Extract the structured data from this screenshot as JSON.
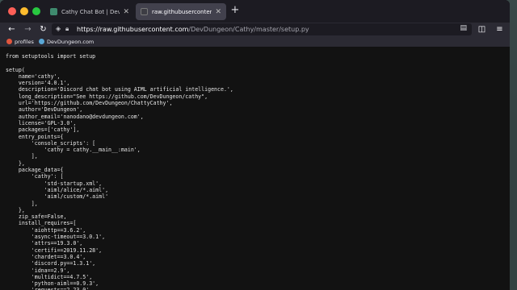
{
  "browser": {
    "tabs": [
      {
        "title": "Cathy Chat Bot | DevDungeon",
        "active": false,
        "close_icon": "close-icon"
      },
      {
        "title": "raw.githubusercontent.com/DevDungeon/Cathy/master/setup.py",
        "active": true,
        "close_icon": "close-icon"
      }
    ],
    "new_tab_label": "+",
    "url_host": "https://raw.githubusercontent.com",
    "url_path": "/DevDungeon/Cathy/master/setup.py",
    "bookmarks": [
      {
        "label": "profiles"
      },
      {
        "label": "DevDungeon.com"
      }
    ],
    "colors": {
      "tab_active": "#42414d",
      "toolbar": "#2b2a33",
      "close_red": "#ff5f57",
      "minimize_yellow": "#febc2e",
      "zoom_green": "#28c840"
    }
  },
  "document": {
    "code_lines": [
      "from setuptools import setup",
      "",
      "setup(",
      "    name='cathy',",
      "    version='4.0.1',",
      "    description='Discord chat bot using AIML artificial intelligence.',",
      "    long_description=\"See https://github.com/DevDungeon/cathy\",",
      "    url='https://github.com/DevDungeon/ChattyCathy',",
      "    author='DevDungeon',",
      "    author_email='nanodano@devdungeon.com',",
      "    license='GPL-3.0',",
      "    packages=['cathy'],",
      "    entry_points={",
      "        'console_scripts': [",
      "            'cathy = cathy.__main__:main',",
      "        ],",
      "    },",
      "    package_data={",
      "        'cathy': [",
      "            'std-startup.xml',",
      "            'aiml/alice/*.aiml',",
      "            'aiml/custom/*.aiml'",
      "        ],",
      "    },",
      "    zip_safe=False,",
      "    install_requires=[",
      "        'aiohttp==3.6.2',",
      "        'async-timeout==3.0.1',",
      "        'attrs==19.3.0',",
      "        'certifi==2019.11.28',",
      "        'chardet==3.0.4',",
      "        'discord.py==1.3.1',",
      "        'idna==2.9',",
      "        'multidict==4.7.5',",
      "        'python-aiml==0.9.3',",
      "        'requests==2.23.0',",
      "        'urllib3==1.25.8',"
    ]
  }
}
